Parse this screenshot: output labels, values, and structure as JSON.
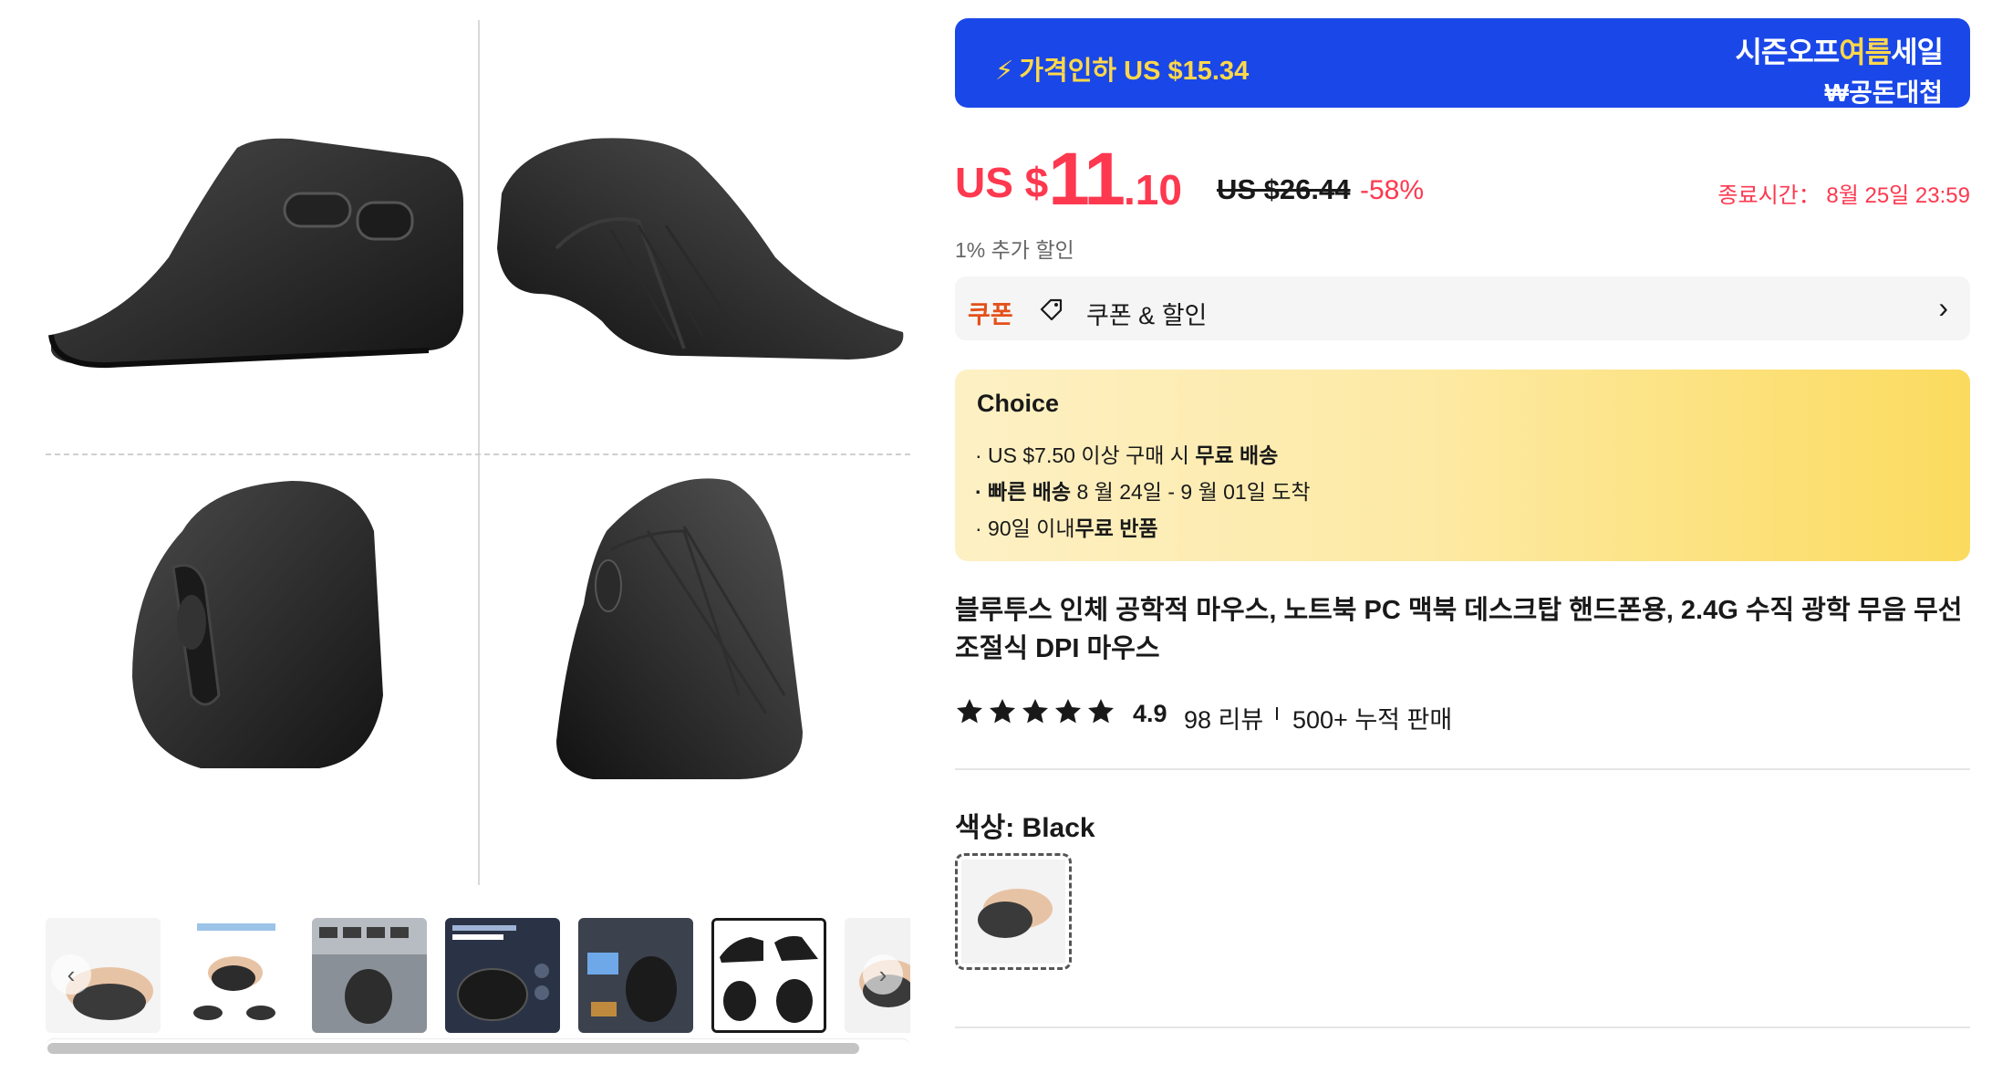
{
  "gallery": {
    "main_image_alt": "",
    "thumbnails_count": 7,
    "active_thumbnail_index": 5,
    "prev_arrow": "‹",
    "next_arrow": "›"
  },
  "promo": {
    "price_drop": "가격인하 US $15.34",
    "sale_title_parts": [
      "시즌오프",
      "여름",
      "세일"
    ],
    "sale_subtitle": "₩공돈대첩",
    "accent_color": "#1a47e8",
    "highlight_color": "#ffd84a"
  },
  "price": {
    "currency": "US $",
    "integer": "11",
    "decimal": ".10",
    "original": "US $26.44",
    "discount": "-58%",
    "ends": "종료시간： 8월 25일 23:59",
    "color": "#fd384f"
  },
  "extra_discount": "1% 추가 할인",
  "coupon": {
    "tag": "쿠폰",
    "label": "쿠폰 & 할인",
    "arrow": "›"
  },
  "choice": {
    "title": "Choice",
    "line1_pre": "· US $7.50 이상 구매 시 ",
    "line1_bold": "무료 배송",
    "line2_bold": "· 빠른 배송",
    "line2_post": " 8 월 24일 - 9 월 01일 도착",
    "line3_pre": "· 90일 이내",
    "line3_bold": "무료 반품"
  },
  "product": {
    "title": "블루투스 인체 공학적 마우스, 노트북 PC 맥북 데스크탑 핸드폰용, 2.4G 수직 광학 무음 무선 조절식 DPI 마우스"
  },
  "rating": {
    "stars": 5,
    "score": "4.9",
    "reviews": "98 리뷰",
    "sold": "500+ 누적 판매"
  },
  "color_option": {
    "label_prefix": "색상: ",
    "selected": "Black"
  }
}
